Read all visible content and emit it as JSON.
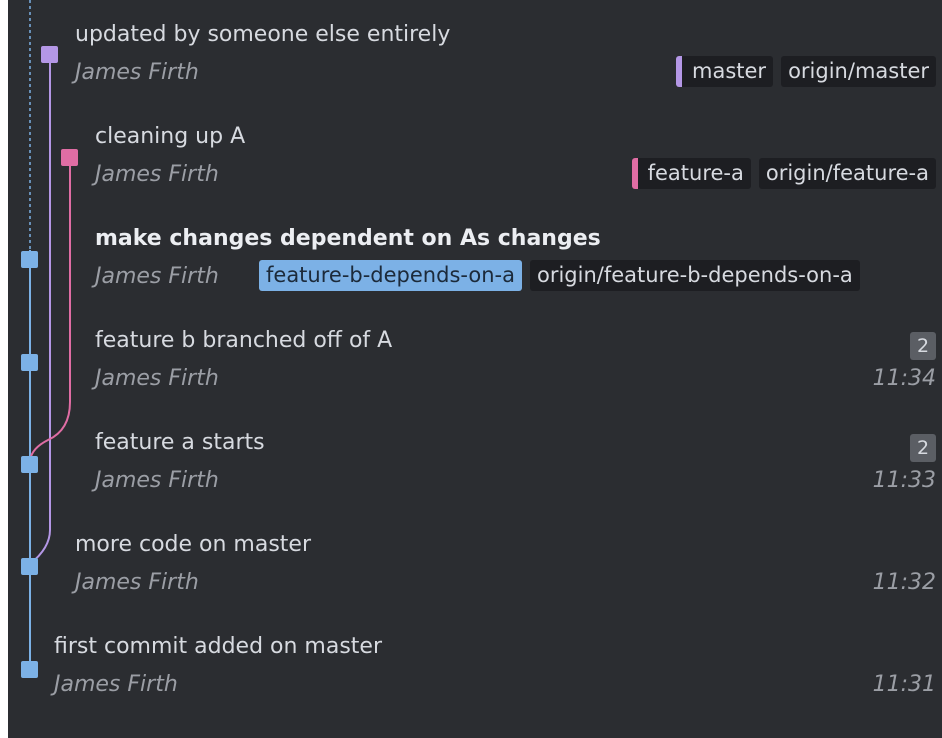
{
  "colors": {
    "master": "#b497e6",
    "feature_a": "#e06da4",
    "feature_b": "#7cb1e6"
  },
  "commits": [
    {
      "summary": "updated by someone else entirely",
      "author": "James Firth",
      "refs": [
        {
          "label": "master",
          "marker": "master"
        },
        {
          "label": "origin/master"
        }
      ],
      "count": "",
      "time": ""
    },
    {
      "summary": "cleaning up A",
      "author": "James Firth",
      "refs": [
        {
          "label": "feature-a",
          "marker": "feature_a"
        },
        {
          "label": "origin/feature-a"
        }
      ],
      "count": "",
      "time": ""
    },
    {
      "summary": "make changes dependent on As changes",
      "author": "James Firth",
      "bold": true,
      "refs": [
        {
          "label": "feature-b-depends-on-a",
          "current": true
        },
        {
          "label": "origin/feature-b-depends-on-a"
        }
      ],
      "count": "",
      "time": ""
    },
    {
      "summary": "feature b branched off of A",
      "author": "James Firth",
      "refs": [],
      "count": "2",
      "time": "11:34"
    },
    {
      "summary": "feature a starts",
      "author": "James Firth",
      "refs": [],
      "count": "2",
      "time": "11:33"
    },
    {
      "summary": "more code on master",
      "author": "James Firth",
      "refs": [],
      "count": "",
      "time": "11:32"
    },
    {
      "summary": "first commit added on master",
      "author": "James Firth",
      "refs": [],
      "count": "",
      "time": "11:31"
    }
  ]
}
